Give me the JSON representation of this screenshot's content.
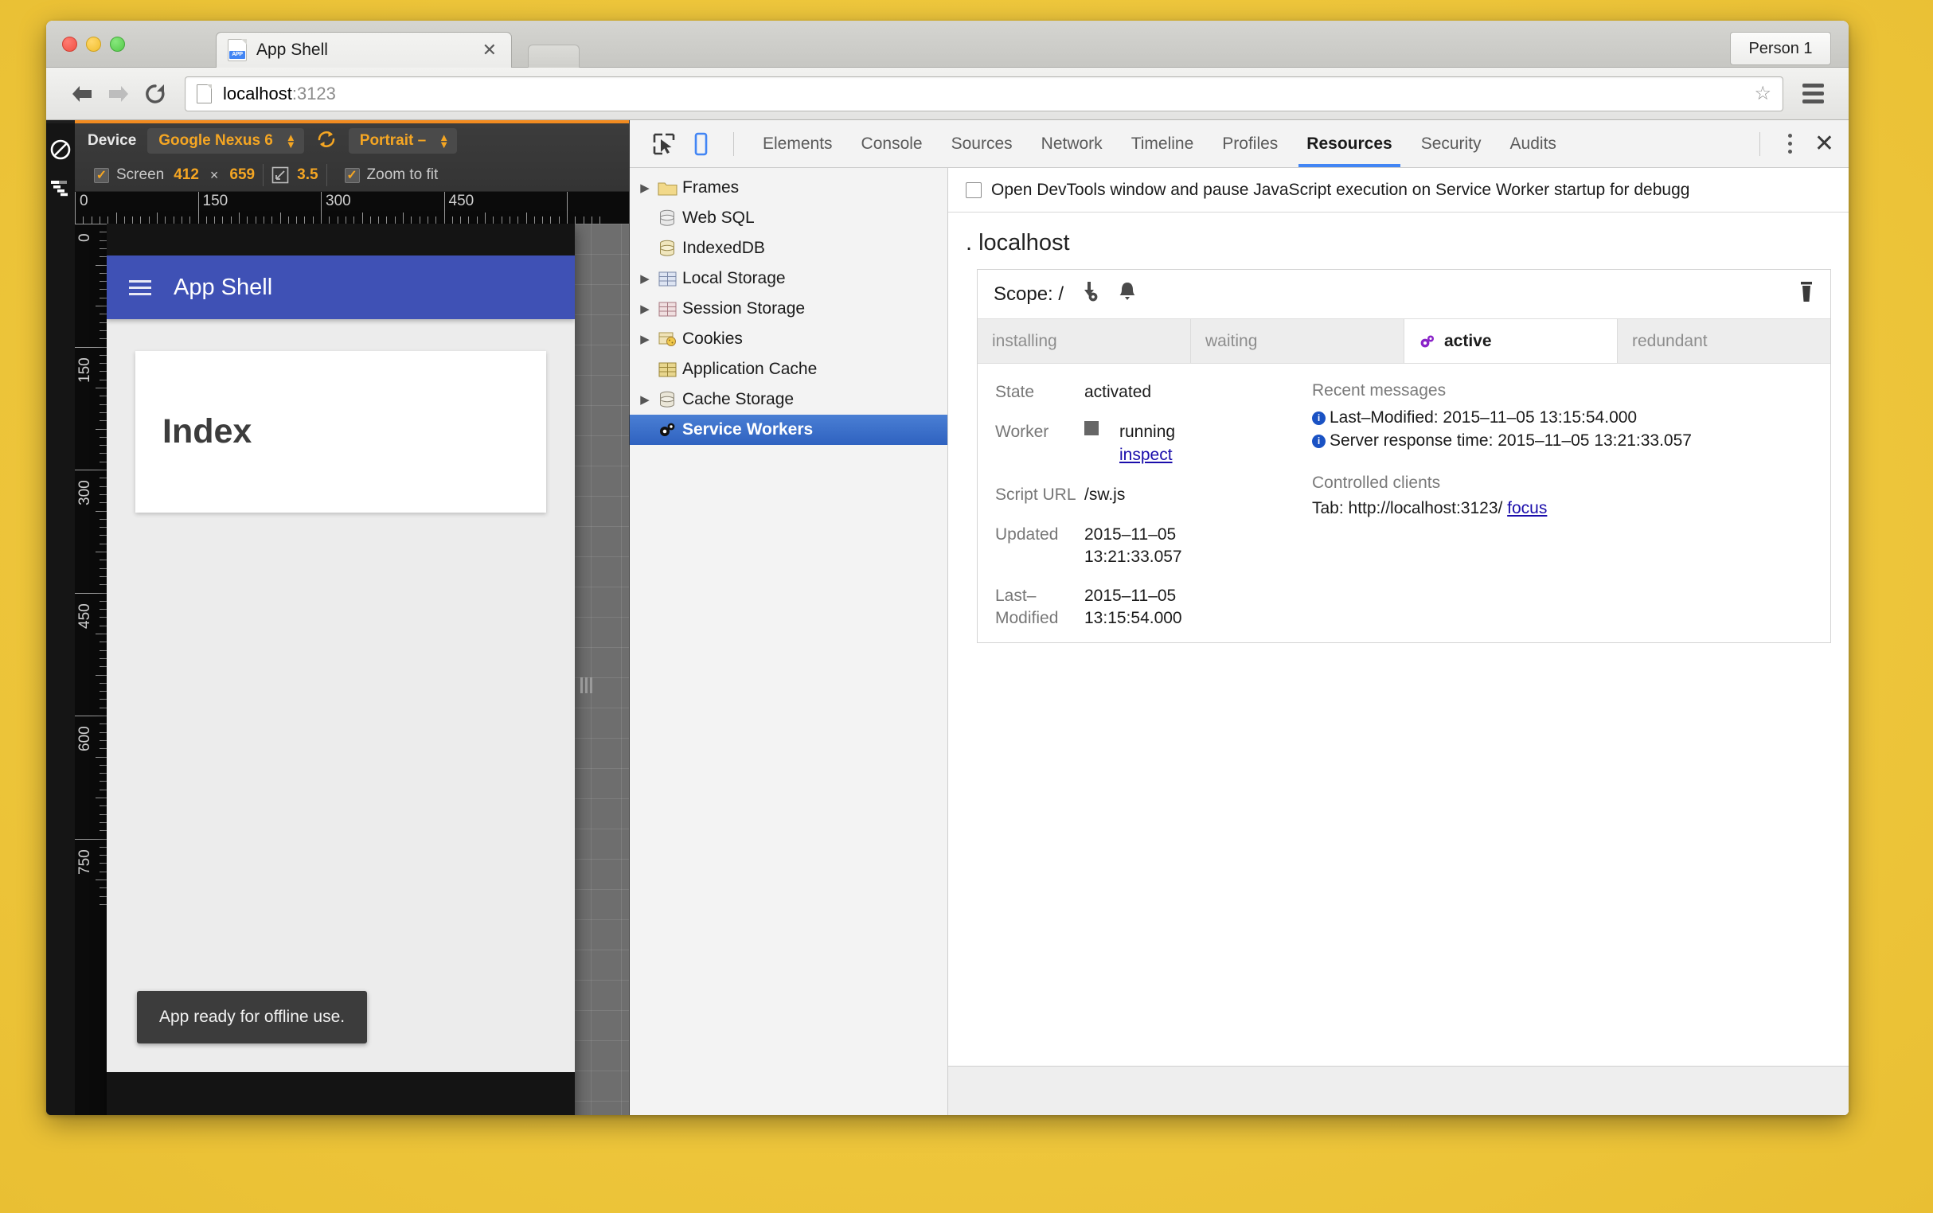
{
  "browser": {
    "profile_button": "Person 1",
    "tab": {
      "title": "App Shell",
      "close": "✕",
      "favicon": "app-favicon"
    },
    "omnibox": {
      "host": "localhost",
      "port": ":3123",
      "star": "☆"
    },
    "nav": {
      "back": "back-arrow",
      "forward": "forward-arrow",
      "reload": "reload-arrow"
    }
  },
  "device_emulation": {
    "device_label": "Device",
    "device_name": "Google Nexus 6",
    "orientation": "Portrait –",
    "rotate_icon": "rotate-icon",
    "screen_label": "Screen",
    "screen_width": "412",
    "screen_multiply": "×",
    "screen_height": "659",
    "dpr_icon": "device-pixel-ratio-icon",
    "dpr_value": "3.5",
    "zoom_to_fit_label": "Zoom to fit",
    "check_glyph": "✓",
    "sidebar_icons": [
      "no-throttling-icon",
      "network-throttling-icon"
    ],
    "ruler_h_ticks": [
      "0",
      "150",
      "300",
      "450"
    ],
    "ruler_v_ticks": [
      "0",
      "150",
      "300",
      "450",
      "600",
      "750"
    ]
  },
  "mobile_app": {
    "app_bar_title": "App Shell",
    "menu_icon": "hamburger-menu-icon",
    "card_title": "Index",
    "toast": "App ready for offline use."
  },
  "devtools": {
    "inspect_icon": "inspect-element-icon",
    "device_toggle_icon": "toggle-device-toolbar-icon",
    "tabs": [
      {
        "label": "Elements",
        "active": false
      },
      {
        "label": "Console",
        "active": false
      },
      {
        "label": "Sources",
        "active": false
      },
      {
        "label": "Network",
        "active": false
      },
      {
        "label": "Timeline",
        "active": false
      },
      {
        "label": "Profiles",
        "active": false
      },
      {
        "label": "Resources",
        "active": true
      },
      {
        "label": "Security",
        "active": false
      },
      {
        "label": "Audits",
        "active": false
      }
    ],
    "kebab_icon": "more-options-icon",
    "close_icon": "✕",
    "accent_color": "#4285f4",
    "resources_tree": [
      {
        "label": "Frames",
        "icon": "folder-icon",
        "expandable": true,
        "selected": false
      },
      {
        "label": "Web SQL",
        "icon": "database-icon",
        "expandable": false,
        "selected": false
      },
      {
        "label": "IndexedDB",
        "icon": "database-icon",
        "expandable": false,
        "selected": false
      },
      {
        "label": "Local Storage",
        "icon": "table-icon",
        "expandable": true,
        "selected": false
      },
      {
        "label": "Session Storage",
        "icon": "table-icon",
        "expandable": true,
        "selected": false
      },
      {
        "label": "Cookies",
        "icon": "cookie-icon",
        "expandable": true,
        "selected": false
      },
      {
        "label": "Application Cache",
        "icon": "table-icon",
        "expandable": false,
        "selected": false
      },
      {
        "label": "Cache Storage",
        "icon": "database-icon",
        "expandable": true,
        "selected": false
      },
      {
        "label": "Service Workers",
        "icon": "gear-icon",
        "expandable": false,
        "selected": true
      }
    ]
  },
  "service_worker": {
    "debug_option_label": "Open DevTools window and pause JavaScript execution on Service Worker startup for debugg",
    "origin": ". localhost",
    "scope_label": "Scope: /",
    "sync_icon": "background-sync-icon",
    "push_icon": "push-notification-icon",
    "delete_icon": "trash-icon",
    "state_tabs": [
      {
        "label": "installing",
        "active": false
      },
      {
        "label": "waiting",
        "active": false
      },
      {
        "label": "active",
        "active": true,
        "icon": "gear-icon"
      },
      {
        "label": "redundant",
        "active": false
      }
    ],
    "details": [
      {
        "key": "State",
        "value": "activated"
      },
      {
        "key": "Worker",
        "value": "running",
        "link": "inspect",
        "status_square": true
      },
      {
        "key": "Script URL",
        "value": "/sw.js"
      },
      {
        "key": "Updated",
        "value": "2015–11–05 13:21:33.057"
      },
      {
        "key": "Last–Modified",
        "value": "2015–11–05 13:15:54.000"
      }
    ],
    "recent_messages_title": "Recent messages",
    "recent_messages": [
      "Last–Modified: 2015–11–05 13:15:54.000",
      "Server response time: 2015–11–05 13:21:33.057"
    ],
    "controlled_clients_title": "Controlled clients",
    "controlled_client": {
      "prefix": "Tab: http://localhost:3123/",
      "action": "focus"
    }
  }
}
